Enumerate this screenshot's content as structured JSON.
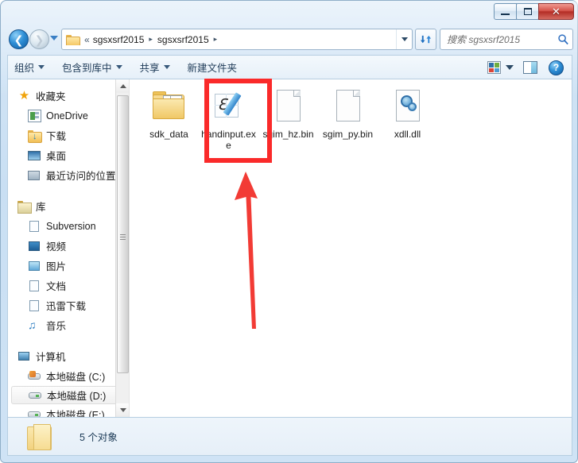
{
  "window": {
    "title": "",
    "caption_buttons": [
      {
        "name": "minimize",
        "label": "—"
      },
      {
        "name": "maximize",
        "label": "□"
      },
      {
        "name": "close",
        "label": "✕"
      }
    ],
    "frame_color": "#c9dff3",
    "accent_color": "#1f7ec0"
  },
  "navigation": {
    "back_label": "←",
    "forward_label": "→",
    "history_dropdown": "▾",
    "refresh_label": "↻"
  },
  "address": {
    "separator_leading": "«",
    "crumbs": [
      {
        "label": "sgsxsrf2015"
      },
      {
        "label": "sgsxsrf2015"
      }
    ],
    "separator": "▸",
    "dropdown": "▾"
  },
  "search": {
    "placeholder": "搜索 sgsxsrf2015",
    "icon": "search-icon"
  },
  "toolbar": {
    "items": [
      {
        "label": "组织",
        "has_caret": true
      },
      {
        "label": "包含到库中",
        "has_caret": true
      },
      {
        "label": "共享",
        "has_caret": true
      },
      {
        "label": "新建文件夹",
        "has_caret": false
      }
    ],
    "view_icon": "view-options-icon",
    "view_caret": "▾",
    "preview_icon": "preview-pane-icon",
    "help_icon": "?",
    "view_colors": [
      "#2f6fa8",
      "#6fae3f",
      "#d9453a",
      "#4f9bd2"
    ]
  },
  "sidebar": {
    "groups": [
      {
        "header": {
          "label": "收藏夹",
          "icon": "star-icon"
        },
        "items": [
          {
            "label": "OneDrive",
            "icon": "onedrive-icon",
            "selected": false
          },
          {
            "label": "下载",
            "icon": "downloads-folder-icon",
            "selected": false
          },
          {
            "label": "桌面",
            "icon": "desktop-icon",
            "selected": false
          },
          {
            "label": "最近访问的位置",
            "icon": "recent-places-icon",
            "selected": false
          }
        ]
      },
      {
        "header": {
          "label": "库",
          "icon": "library-folder-icon"
        },
        "items": [
          {
            "label": "Subversion",
            "icon": "document-icon",
            "selected": false
          },
          {
            "label": "视频",
            "icon": "video-icon",
            "selected": false
          },
          {
            "label": "图片",
            "icon": "pictures-icon",
            "selected": false
          },
          {
            "label": "文档",
            "icon": "document-icon",
            "selected": false
          },
          {
            "label": "迅雷下载",
            "icon": "document-icon",
            "selected": false
          },
          {
            "label": "音乐",
            "icon": "music-icon",
            "selected": false
          }
        ]
      },
      {
        "header": {
          "label": "计算机",
          "icon": "computer-icon"
        },
        "items": [
          {
            "label": "本地磁盘 (C:)",
            "icon": "system-drive-icon",
            "selected": false
          },
          {
            "label": "本地磁盘 (D:)",
            "icon": "drive-icon",
            "selected": true
          },
          {
            "label": "本地磁盘 (E:)",
            "icon": "drive-icon",
            "selected": false
          }
        ]
      }
    ],
    "scrollbar": {
      "up_arrow": "▴",
      "down_arrow": "▾"
    }
  },
  "files": [
    {
      "name": "sdk_data",
      "icon": "folder-with-documents-icon",
      "highlighted": false
    },
    {
      "name": "handinput.exe",
      "icon": "handwriting-input-exe-icon",
      "highlighted": true
    },
    {
      "name": "sgim_hz.bin",
      "icon": "blank-document-icon",
      "highlighted": false
    },
    {
      "name": "sgim_py.bin",
      "icon": "blank-document-icon",
      "highlighted": false
    },
    {
      "name": "xdll.dll",
      "icon": "dll-gear-icon",
      "highlighted": false
    }
  ],
  "annotations": {
    "highlight_color": "#fa2a2a",
    "highlight_target": "handinput.exe",
    "arrow_color": "#f23b35",
    "arrow_direction": "up",
    "arrow_points_to": "handinput.exe"
  },
  "status": {
    "icon": "folder-icon",
    "text": "5 个对象"
  }
}
